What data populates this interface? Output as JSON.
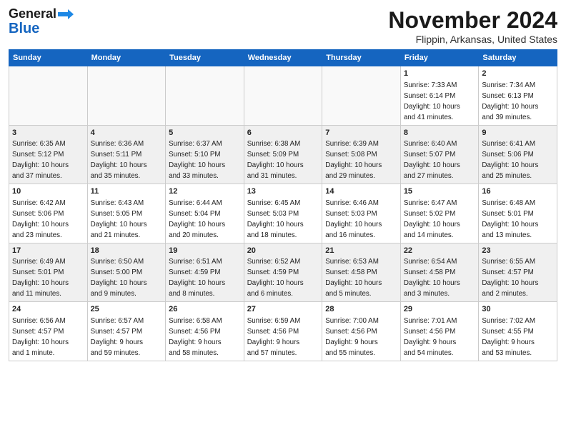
{
  "header": {
    "logo_line1": "General",
    "logo_line2": "Blue",
    "title": "November 2024",
    "subtitle": "Flippin, Arkansas, United States"
  },
  "weekdays": [
    "Sunday",
    "Monday",
    "Tuesday",
    "Wednesday",
    "Thursday",
    "Friday",
    "Saturday"
  ],
  "weeks": [
    [
      {
        "day": "",
        "info": ""
      },
      {
        "day": "",
        "info": ""
      },
      {
        "day": "",
        "info": ""
      },
      {
        "day": "",
        "info": ""
      },
      {
        "day": "",
        "info": ""
      },
      {
        "day": "1",
        "info": "Sunrise: 7:33 AM\nSunset: 6:14 PM\nDaylight: 10 hours\nand 41 minutes."
      },
      {
        "day": "2",
        "info": "Sunrise: 7:34 AM\nSunset: 6:13 PM\nDaylight: 10 hours\nand 39 minutes."
      }
    ],
    [
      {
        "day": "3",
        "info": "Sunrise: 6:35 AM\nSunset: 5:12 PM\nDaylight: 10 hours\nand 37 minutes."
      },
      {
        "day": "4",
        "info": "Sunrise: 6:36 AM\nSunset: 5:11 PM\nDaylight: 10 hours\nand 35 minutes."
      },
      {
        "day": "5",
        "info": "Sunrise: 6:37 AM\nSunset: 5:10 PM\nDaylight: 10 hours\nand 33 minutes."
      },
      {
        "day": "6",
        "info": "Sunrise: 6:38 AM\nSunset: 5:09 PM\nDaylight: 10 hours\nand 31 minutes."
      },
      {
        "day": "7",
        "info": "Sunrise: 6:39 AM\nSunset: 5:08 PM\nDaylight: 10 hours\nand 29 minutes."
      },
      {
        "day": "8",
        "info": "Sunrise: 6:40 AM\nSunset: 5:07 PM\nDaylight: 10 hours\nand 27 minutes."
      },
      {
        "day": "9",
        "info": "Sunrise: 6:41 AM\nSunset: 5:06 PM\nDaylight: 10 hours\nand 25 minutes."
      }
    ],
    [
      {
        "day": "10",
        "info": "Sunrise: 6:42 AM\nSunset: 5:06 PM\nDaylight: 10 hours\nand 23 minutes."
      },
      {
        "day": "11",
        "info": "Sunrise: 6:43 AM\nSunset: 5:05 PM\nDaylight: 10 hours\nand 21 minutes."
      },
      {
        "day": "12",
        "info": "Sunrise: 6:44 AM\nSunset: 5:04 PM\nDaylight: 10 hours\nand 20 minutes."
      },
      {
        "day": "13",
        "info": "Sunrise: 6:45 AM\nSunset: 5:03 PM\nDaylight: 10 hours\nand 18 minutes."
      },
      {
        "day": "14",
        "info": "Sunrise: 6:46 AM\nSunset: 5:03 PM\nDaylight: 10 hours\nand 16 minutes."
      },
      {
        "day": "15",
        "info": "Sunrise: 6:47 AM\nSunset: 5:02 PM\nDaylight: 10 hours\nand 14 minutes."
      },
      {
        "day": "16",
        "info": "Sunrise: 6:48 AM\nSunset: 5:01 PM\nDaylight: 10 hours\nand 13 minutes."
      }
    ],
    [
      {
        "day": "17",
        "info": "Sunrise: 6:49 AM\nSunset: 5:01 PM\nDaylight: 10 hours\nand 11 minutes."
      },
      {
        "day": "18",
        "info": "Sunrise: 6:50 AM\nSunset: 5:00 PM\nDaylight: 10 hours\nand 9 minutes."
      },
      {
        "day": "19",
        "info": "Sunrise: 6:51 AM\nSunset: 4:59 PM\nDaylight: 10 hours\nand 8 minutes."
      },
      {
        "day": "20",
        "info": "Sunrise: 6:52 AM\nSunset: 4:59 PM\nDaylight: 10 hours\nand 6 minutes."
      },
      {
        "day": "21",
        "info": "Sunrise: 6:53 AM\nSunset: 4:58 PM\nDaylight: 10 hours\nand 5 minutes."
      },
      {
        "day": "22",
        "info": "Sunrise: 6:54 AM\nSunset: 4:58 PM\nDaylight: 10 hours\nand 3 minutes."
      },
      {
        "day": "23",
        "info": "Sunrise: 6:55 AM\nSunset: 4:57 PM\nDaylight: 10 hours\nand 2 minutes."
      }
    ],
    [
      {
        "day": "24",
        "info": "Sunrise: 6:56 AM\nSunset: 4:57 PM\nDaylight: 10 hours\nand 1 minute."
      },
      {
        "day": "25",
        "info": "Sunrise: 6:57 AM\nSunset: 4:57 PM\nDaylight: 9 hours\nand 59 minutes."
      },
      {
        "day": "26",
        "info": "Sunrise: 6:58 AM\nSunset: 4:56 PM\nDaylight: 9 hours\nand 58 minutes."
      },
      {
        "day": "27",
        "info": "Sunrise: 6:59 AM\nSunset: 4:56 PM\nDaylight: 9 hours\nand 57 minutes."
      },
      {
        "day": "28",
        "info": "Sunrise: 7:00 AM\nSunset: 4:56 PM\nDaylight: 9 hours\nand 55 minutes."
      },
      {
        "day": "29",
        "info": "Sunrise: 7:01 AM\nSunset: 4:56 PM\nDaylight: 9 hours\nand 54 minutes."
      },
      {
        "day": "30",
        "info": "Sunrise: 7:02 AM\nSunset: 4:55 PM\nDaylight: 9 hours\nand 53 minutes."
      }
    ]
  ]
}
